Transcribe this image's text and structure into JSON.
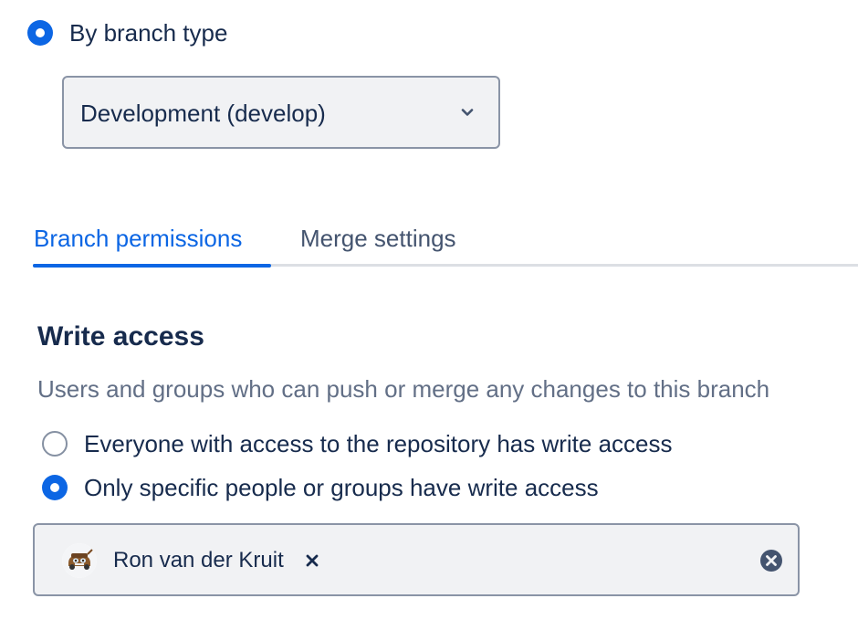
{
  "branch_selection": {
    "option_label": "By branch type",
    "selected": true,
    "dropdown": {
      "value": "Development (develop)",
      "icon": "chevron-down-icon"
    }
  },
  "tabs": [
    {
      "label": "Branch permissions",
      "active": true
    },
    {
      "label": "Merge settings",
      "active": false
    }
  ],
  "write_access": {
    "title": "Write access",
    "description": "Users and groups who can push or merge any changes to this branch",
    "options": [
      {
        "label": "Everyone with access to the repository has write access",
        "selected": false
      },
      {
        "label": "Only specific people or groups have write access",
        "selected": true
      }
    ],
    "selected_users": [
      {
        "name": "Ron van der Kruit",
        "avatar_icon": "tow-truck-avatar-icon",
        "remove_icon": "remove-icon"
      }
    ],
    "clear_icon": "clear-circle-icon"
  },
  "colors": {
    "accent": "#0c66e4",
    "text": "#172b4d",
    "subtle_text": "#626f86",
    "field_bg": "#f1f2f4",
    "field_border": "#8a94a6"
  }
}
